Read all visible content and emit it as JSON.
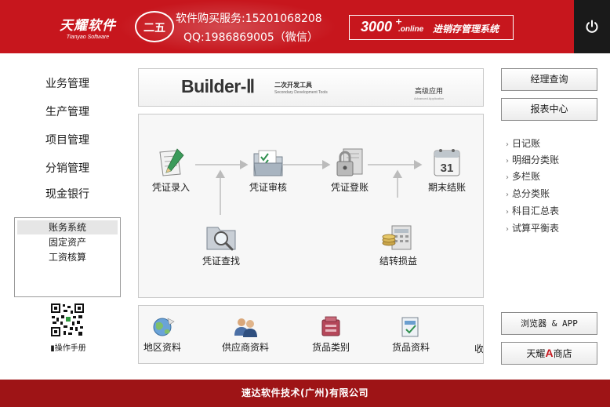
{
  "header": {
    "brand_cn": "天耀软件",
    "brand_en": "Tianyao Software",
    "seal_text": "二五",
    "sales_line": "软件购买服务:15201068208",
    "qq_line": "QQ:1986869005（微信）",
    "badge_number": "3000",
    "badge_plus": "+",
    "badge_online": ".online",
    "badge_label": "进销存管理系统",
    "power_icon": "power-icon",
    "colors": {
      "bar": "#c7161d",
      "power_bg": "#1a1a1a"
    }
  },
  "nav": {
    "items": [
      {
        "label": "业务管理"
      },
      {
        "label": "生产管理"
      },
      {
        "label": "项目管理"
      },
      {
        "label": "分销管理"
      },
      {
        "label": "现金银行"
      }
    ],
    "sub_items": [
      {
        "label": "账务系统",
        "active": true
      },
      {
        "label": "固定资产"
      },
      {
        "label": "工资核算"
      }
    ],
    "manual_label": "操作手册"
  },
  "banner": {
    "title": "Builder-Ⅱ",
    "subtitle_cn": "二次开发工具",
    "subtitle_en": "Secondary Development Tools",
    "advanced_cn": "高级应用",
    "advanced_en": "Advanced Application"
  },
  "flow": {
    "nodes": [
      {
        "label": "凭证录入",
        "icon": "voucher-entry-icon"
      },
      {
        "label": "凭证审核",
        "icon": "voucher-audit-icon"
      },
      {
        "label": "凭证登账",
        "icon": "voucher-post-icon"
      },
      {
        "label": "期末结账",
        "icon": "period-close-icon"
      },
      {
        "label": "凭证查找",
        "icon": "voucher-search-icon"
      },
      {
        "label": "结转损益",
        "icon": "profit-loss-transfer-icon"
      }
    ],
    "calendar_day": "31"
  },
  "strip": {
    "items": [
      {
        "label": "地区资料",
        "icon": "region-icon"
      },
      {
        "label": "供应商资料",
        "icon": "supplier-icon"
      },
      {
        "label": "货品类别",
        "icon": "goods-category-icon"
      },
      {
        "label": "货品资料",
        "icon": "goods-info-icon"
      },
      {
        "label": "收"
      }
    ]
  },
  "right": {
    "manager_query": "经理查询",
    "report_center": "报表中心",
    "links": [
      {
        "label": "日记账"
      },
      {
        "label": "明细分类账"
      },
      {
        "label": "多栏账"
      },
      {
        "label": "总分类账"
      },
      {
        "label": "科目汇总表"
      },
      {
        "label": "试算平衡表"
      }
    ],
    "browser_app": "浏览器 & APP",
    "shop_pre": "天耀",
    "shop_mark": "A",
    "shop_post": "商店"
  },
  "footer": {
    "company": "速达软件技术(广州)有限公司",
    "color": "#9e1416"
  }
}
